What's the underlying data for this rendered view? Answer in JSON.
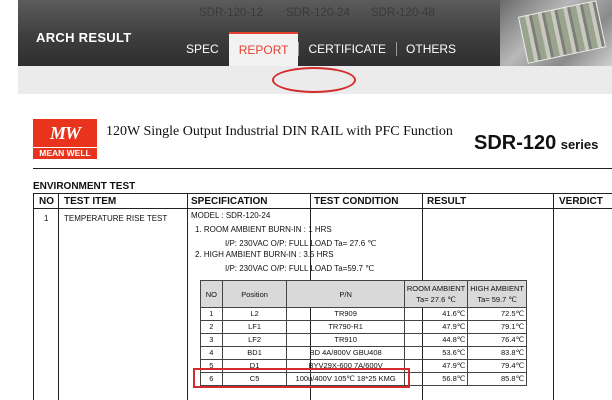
{
  "header": {
    "search_title": "ARCH RESULT",
    "tabs": [
      {
        "label": "SPEC",
        "active": false
      },
      {
        "label": "REPORT",
        "active": true
      },
      {
        "label": "CERTIFICATE",
        "active": false
      },
      {
        "label": "OTHERS",
        "active": false
      }
    ],
    "models": [
      "SDR-120-12",
      "SDR-120-24",
      "SDR-120-48"
    ],
    "selected_model": "SDR-120-24",
    "colors": {
      "accent": "#e6412f",
      "annotation": "#d42a2a",
      "banner": "#3e3e3e"
    }
  },
  "document": {
    "logo_mark": "MW",
    "logo_word": "MEAN WELL",
    "title": "120W Single Output Industrial DIN RAIL with PFC Function",
    "series_main": "SDR-120",
    "series_suffix": "series",
    "section": "ENVIRONMENT TEST",
    "table_headers": [
      "NO",
      "TEST ITEM",
      "SPECIFICATION",
      "TEST CONDITION",
      "RESULT",
      "VERDICT"
    ],
    "row": {
      "no": "1",
      "test_item": "TEMPERATURE RISE TEST",
      "spec_lines": [
        "MODEL : SDR-120-24",
        "1. ROOM AMBIENT   BURN-IN : 1 HRS",
        "I/P: 230VAC    O/P: FULL LOAD    Ta= 27.6 ℃",
        "2. HIGH AMBIENT    BURN-IN : 3.5 HRS",
        "I/P: 230VAC    O/P: FULL LOAD    Ta=59.7 ℃"
      ]
    },
    "components": {
      "headers": {
        "no": "NO",
        "position": "Position",
        "pn": "P/N",
        "room": [
          "ROOM AMBIENT",
          "Ta= 27.6 ℃"
        ],
        "high": [
          "HIGH AMBIENT",
          "Ta= 59.7 ℃"
        ]
      },
      "rows": [
        {
          "no": "1",
          "position": "L2",
          "pn": "TR909",
          "room": "41.6℃",
          "high": "72.5℃"
        },
        {
          "no": "2",
          "position": "LF1",
          "pn": "TR790-R1",
          "room": "47.9℃",
          "high": "79.1℃"
        },
        {
          "no": "3",
          "position": "LF2",
          "pn": "TR910",
          "room": "44.8℃",
          "high": "76.4℃"
        },
        {
          "no": "4",
          "position": "BD1",
          "pn": "BD 4A/800V    GBU408",
          "room": "53.6℃",
          "high": "83.8℃"
        },
        {
          "no": "5",
          "position": "D1",
          "pn": "BYV29X-600 7A/600V",
          "room": "47.9℃",
          "high": "79.4℃"
        },
        {
          "no": "6",
          "position": "C5",
          "pn": "100u/400V 105℃ 18*25 KMG",
          "room": "56.8℃",
          "high": "85.8℃"
        }
      ]
    }
  }
}
